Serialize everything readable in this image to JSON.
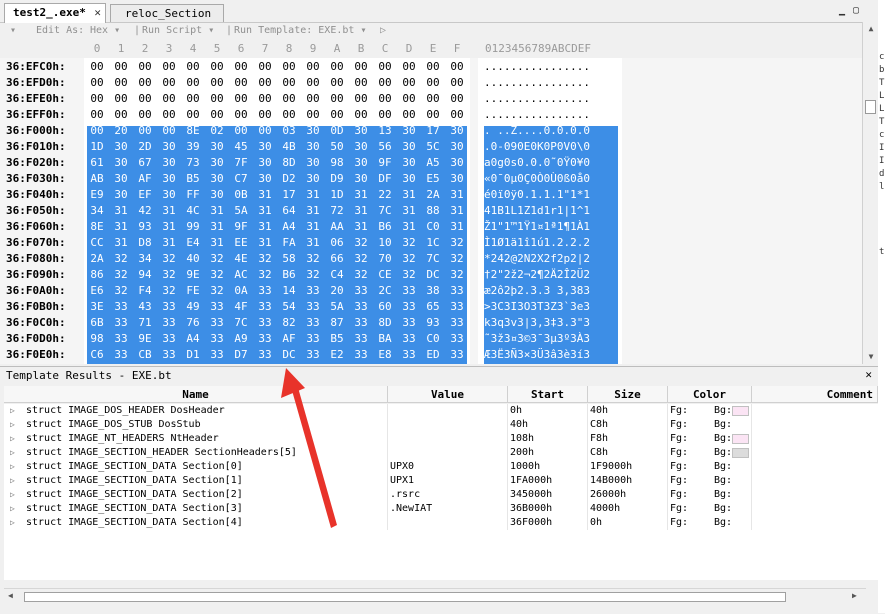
{
  "tabs": [
    {
      "label": "test2_.exe*",
      "active": true
    },
    {
      "label": "reloc_Section",
      "active": false
    }
  ],
  "toolbar": {
    "edit_as_label": "Edit As:",
    "edit_as_value": "Hex",
    "run_script": "Run Script",
    "run_template": "Run Template: EXE.bt"
  },
  "columns": [
    "0",
    "1",
    "2",
    "3",
    "4",
    "5",
    "6",
    "7",
    "8",
    "9",
    "A",
    "B",
    "C",
    "D",
    "E",
    "F"
  ],
  "ascii_header": "0123456789ABCDEF",
  "rows": [
    {
      "addr": "36:EFC0h:",
      "hex": [
        "00",
        "00",
        "00",
        "00",
        "00",
        "00",
        "00",
        "00",
        "00",
        "00",
        "00",
        "00",
        "00",
        "00",
        "00",
        "00"
      ],
      "ascii": "................",
      "selected": false
    },
    {
      "addr": "36:EFD0h:",
      "hex": [
        "00",
        "00",
        "00",
        "00",
        "00",
        "00",
        "00",
        "00",
        "00",
        "00",
        "00",
        "00",
        "00",
        "00",
        "00",
        "00"
      ],
      "ascii": "................",
      "selected": false
    },
    {
      "addr": "36:EFE0h:",
      "hex": [
        "00",
        "00",
        "00",
        "00",
        "00",
        "00",
        "00",
        "00",
        "00",
        "00",
        "00",
        "00",
        "00",
        "00",
        "00",
        "00"
      ],
      "ascii": "................",
      "selected": false
    },
    {
      "addr": "36:EFF0h:",
      "hex": [
        "00",
        "00",
        "00",
        "00",
        "00",
        "00",
        "00",
        "00",
        "00",
        "00",
        "00",
        "00",
        "00",
        "00",
        "00",
        "00"
      ],
      "ascii": "................",
      "selected": false
    },
    {
      "addr": "36:F000h:",
      "hex": [
        "00",
        "20",
        "00",
        "00",
        "8E",
        "02",
        "00",
        "00",
        "03",
        "30",
        "0D",
        "30",
        "13",
        "30",
        "17",
        "30"
      ],
      "ascii": ". ..Ž....0.0.0.0",
      "selected": true
    },
    {
      "addr": "36:F010h:",
      "hex": [
        "1D",
        "30",
        "2D",
        "30",
        "39",
        "30",
        "45",
        "30",
        "4B",
        "30",
        "50",
        "30",
        "56",
        "30",
        "5C",
        "30"
      ],
      "ascii": ".0-090E0K0P0V0\\0",
      "selected": true
    },
    {
      "addr": "36:F020h:",
      "hex": [
        "61",
        "30",
        "67",
        "30",
        "73",
        "30",
        "7F",
        "30",
        "8D",
        "30",
        "98",
        "30",
        "9F",
        "30",
        "A5",
        "30"
      ],
      "ascii": "a0g0s0.0.0˜0Ÿ0¥0",
      "selected": true
    },
    {
      "addr": "36:F030h:",
      "hex": [
        "AB",
        "30",
        "AF",
        "30",
        "B5",
        "30",
        "C7",
        "30",
        "D2",
        "30",
        "D9",
        "30",
        "DF",
        "30",
        "E5",
        "30"
      ],
      "ascii": "«0¯0µ0Ç0Ò0Ù0ß0å0",
      "selected": true
    },
    {
      "addr": "36:F040h:",
      "hex": [
        "E9",
        "30",
        "EF",
        "30",
        "FF",
        "30",
        "0B",
        "31",
        "17",
        "31",
        "1D",
        "31",
        "22",
        "31",
        "2A",
        "31"
      ],
      "ascii": "é0ï0ÿ0.1.1.1\"1*1",
      "selected": true
    },
    {
      "addr": "36:F050h:",
      "hex": [
        "34",
        "31",
        "42",
        "31",
        "4C",
        "31",
        "5A",
        "31",
        "64",
        "31",
        "72",
        "31",
        "7C",
        "31",
        "88",
        "31"
      ],
      "ascii": "41B1L1Z1d1r1|1^1",
      "selected": true
    },
    {
      "addr": "36:F060h:",
      "hex": [
        "8E",
        "31",
        "93",
        "31",
        "99",
        "31",
        "9F",
        "31",
        "A4",
        "31",
        "AA",
        "31",
        "B6",
        "31",
        "C0",
        "31"
      ],
      "ascii": "Ž1\"1™1Ÿ1¤1ª1¶1À1",
      "selected": true
    },
    {
      "addr": "36:F070h:",
      "hex": [
        "CC",
        "31",
        "D8",
        "31",
        "E4",
        "31",
        "EE",
        "31",
        "FA",
        "31",
        "06",
        "32",
        "10",
        "32",
        "1C",
        "32"
      ],
      "ascii": "Ì1Ø1ä1î1ú1.2.2.2",
      "selected": true
    },
    {
      "addr": "36:F080h:",
      "hex": [
        "2A",
        "32",
        "34",
        "32",
        "40",
        "32",
        "4E",
        "32",
        "58",
        "32",
        "66",
        "32",
        "70",
        "32",
        "7C",
        "32"
      ],
      "ascii": "*242@2N2X2f2p2|2",
      "selected": true
    },
    {
      "addr": "36:F090h:",
      "hex": [
        "86",
        "32",
        "94",
        "32",
        "9E",
        "32",
        "AC",
        "32",
        "B6",
        "32",
        "C4",
        "32",
        "CE",
        "32",
        "DC",
        "32"
      ],
      "ascii": "†2\"2ž2¬2¶2Ä2Î2Ü2",
      "selected": true
    },
    {
      "addr": "36:F0A0h:",
      "hex": [
        "E6",
        "32",
        "F4",
        "32",
        "FE",
        "32",
        "0A",
        "33",
        "14",
        "33",
        "20",
        "33",
        "2C",
        "33",
        "38",
        "33"
      ],
      "ascii": "æ2ô2þ2.3.3 3,383",
      "selected": true
    },
    {
      "addr": "36:F0B0h:",
      "hex": [
        "3E",
        "33",
        "43",
        "33",
        "49",
        "33",
        "4F",
        "33",
        "54",
        "33",
        "5A",
        "33",
        "60",
        "33",
        "65",
        "33"
      ],
      "ascii": ">3C3I3O3T3Z3`3e3",
      "selected": true
    },
    {
      "addr": "36:F0C0h:",
      "hex": [
        "6B",
        "33",
        "71",
        "33",
        "76",
        "33",
        "7C",
        "33",
        "82",
        "33",
        "87",
        "33",
        "8D",
        "33",
        "93",
        "33"
      ],
      "ascii": "k3q3v3|3,3‡3.3\"3",
      "selected": true
    },
    {
      "addr": "36:F0D0h:",
      "hex": [
        "98",
        "33",
        "9E",
        "33",
        "A4",
        "33",
        "A9",
        "33",
        "AF",
        "33",
        "B5",
        "33",
        "BA",
        "33",
        "C0",
        "33"
      ],
      "ascii": "˜3ž3¤3©3¯3µ3º3À3",
      "selected": true
    },
    {
      "addr": "36:F0E0h:",
      "hex": [
        "C6",
        "33",
        "CB",
        "33",
        "D1",
        "33",
        "D7",
        "33",
        "DC",
        "33",
        "E2",
        "33",
        "E8",
        "33",
        "ED",
        "33"
      ],
      "ascii": "Æ3Ë3Ñ3×3Ü3â3è3í3",
      "selected": true
    }
  ],
  "results": {
    "title": "Template Results - EXE.bt",
    "close": "✕",
    "headers": {
      "name": "Name",
      "value": "Value",
      "start": "Start",
      "size": "Size",
      "color": "Color",
      "comment": "Comment"
    },
    "rows": [
      {
        "name": "struct IMAGE_DOS_HEADER DosHeader",
        "value": "",
        "start": "0h",
        "size": "40h",
        "fg": "Fg:",
        "bg": "Bg:",
        "bgcolor": "#fbe4f4"
      },
      {
        "name": "struct IMAGE_DOS_STUB DosStub",
        "value": "",
        "start": "40h",
        "size": "C8h",
        "fg": "Fg:",
        "bg": "Bg:",
        "bgcolor": ""
      },
      {
        "name": "struct IMAGE_NT_HEADERS NtHeader",
        "value": "",
        "start": "108h",
        "size": "F8h",
        "fg": "Fg:",
        "bg": "Bg:",
        "bgcolor": "#fbe4f4"
      },
      {
        "name": "struct IMAGE_SECTION_HEADER SectionHeaders[5]",
        "value": "",
        "start": "200h",
        "size": "C8h",
        "fg": "Fg:",
        "bg": "Bg:",
        "bgcolor": "#dcdcdc"
      },
      {
        "name": "struct IMAGE_SECTION_DATA Section[0]",
        "value": "UPX0",
        "start": "1000h",
        "size": "1F9000h",
        "fg": "Fg:",
        "bg": "Bg:",
        "bgcolor": ""
      },
      {
        "name": "struct IMAGE_SECTION_DATA Section[1]",
        "value": "UPX1",
        "start": "1FA000h",
        "size": "14B000h",
        "fg": "Fg:",
        "bg": "Bg:",
        "bgcolor": ""
      },
      {
        "name": "struct IMAGE_SECTION_DATA Section[2]",
        "value": ".rsrc",
        "start": "345000h",
        "size": "26000h",
        "fg": "Fg:",
        "bg": "Bg:",
        "bgcolor": ""
      },
      {
        "name": "struct IMAGE_SECTION_DATA Section[3]",
        "value": ".NewIAT",
        "start": "36B000h",
        "size": "4000h",
        "fg": "Fg:",
        "bg": "Bg:",
        "bgcolor": ""
      },
      {
        "name": "struct IMAGE_SECTION_DATA Section[4]",
        "value": "",
        "start": "36F000h",
        "size": "0h",
        "fg": "Fg:",
        "bg": "Bg:",
        "bgcolor": ""
      }
    ]
  },
  "right_strip": [
    "c",
    "b",
    "T",
    "L",
    "L",
    "T",
    "c",
    "I",
    "I",
    "d",
    "l",
    "",
    "",
    "",
    "",
    "t"
  ],
  "colors": {
    "selection": "#3d8ee6",
    "arrow": "#e8332a"
  }
}
